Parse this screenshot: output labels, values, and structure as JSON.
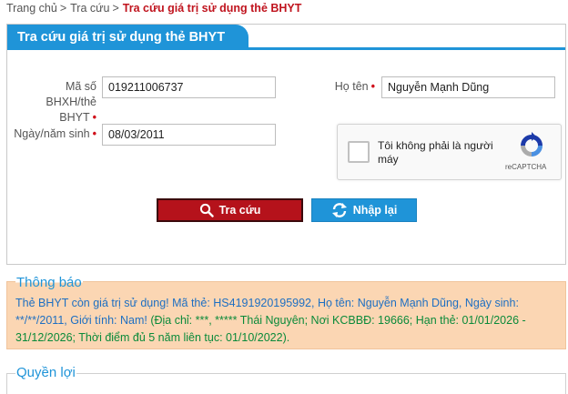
{
  "breadcrumb": {
    "home": "Trang chủ",
    "sep1": ">",
    "lookup": "Tra cứu",
    "sep2": ">",
    "current": "Tra cứu giá trị sử dụng thẻ BHYT"
  },
  "panel": {
    "title": "Tra cứu giá trị sử dụng thẻ BHYT"
  },
  "form": {
    "id_label_1": "Mã số BHXH/thẻ",
    "id_label_2": "BHYT",
    "id_value": "019211006737",
    "name_label": "Họ tên",
    "name_value": "Nguyễn Mạnh Dũng",
    "dob_label": "Ngày/năm sinh",
    "dob_value": "08/03/2011",
    "required_mark": "•"
  },
  "captcha": {
    "text": "Tôi không phải là người máy",
    "brand": "reCAPTCHA"
  },
  "buttons": {
    "search": "Tra cứu",
    "reset": "Nhập lại"
  },
  "notice": {
    "title": "Thông báo",
    "status": "Thẻ BHYT còn giá trị sử dụng! Mã thẻ: HS4191920195992, Họ tên: Nguyễn Mạnh Dũng, Ngày sinh: **/**/2011, Giới tính: Nam!",
    "details": " (Địa chỉ: ***, ***** Thái Nguyên; Nơi KCBBĐ: 19666; Hạn thẻ: 01/01/2026 - 31/12/2026; Thời điểm đủ 5 năm liên tục: 01/10/2022)."
  },
  "benefits": {
    "title": "Quyền lợi"
  },
  "colors": {
    "accent": "#1f94d8",
    "danger": "#b5121b",
    "success": "#0a8a3a",
    "notice_bg": "#fbd6b3"
  },
  "icons": {
    "search_button": "search-icon",
    "reset_button": "refresh-icon",
    "captcha": "recaptcha-logo-icon"
  }
}
